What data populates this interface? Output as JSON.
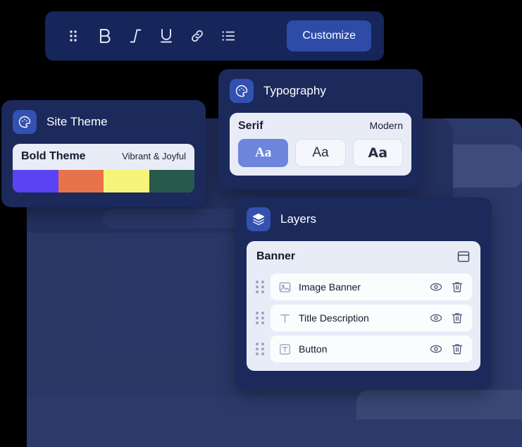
{
  "toolbar": {
    "name": "text-formatting-toolbar",
    "tools": [
      {
        "id": "drag-handle",
        "icon": "drag-handle-icon",
        "label": "Drag"
      },
      {
        "id": "bold",
        "icon": "bold-icon",
        "label": "B"
      },
      {
        "id": "italic",
        "icon": "italic-icon",
        "label": "I"
      },
      {
        "id": "underline",
        "icon": "underline-icon",
        "label": "U"
      },
      {
        "id": "link",
        "icon": "link-icon",
        "label": "Link"
      },
      {
        "id": "list",
        "icon": "bulleted-list-icon",
        "label": "List"
      }
    ],
    "customize_label": "Customize",
    "customize_color": "#2E4BA8",
    "background_color": "#16255A"
  },
  "typography_card": {
    "icon": "palette-icon",
    "title": "Typography",
    "left_label": "Serif",
    "right_label": "Modern",
    "options": [
      {
        "label": "Aa",
        "style": "serif",
        "selected": true
      },
      {
        "label": "Aa",
        "style": "sans",
        "selected": false
      },
      {
        "label": "Aa",
        "style": "bold",
        "selected": false
      }
    ],
    "selected_color": "#6E85DE"
  },
  "site_theme_card": {
    "icon": "palette-icon",
    "title": "Site Theme",
    "theme_name": "Bold Theme",
    "theme_mood": "Vibrant & Joyful",
    "palette": [
      "#5B42F3",
      "#E8734A",
      "#F5F57A",
      "#27594D"
    ]
  },
  "layers_card": {
    "icon": "layers-icon",
    "title": "Layers",
    "section_label": "Banner",
    "section_icon": "layout-window-icon",
    "items": [
      {
        "label": "Image Banner",
        "type_icon": "image-icon"
      },
      {
        "label": "Title Description",
        "type_icon": "text-t-icon"
      },
      {
        "label": "Button",
        "type_icon": "button-boxed-t-icon"
      }
    ],
    "row_actions": [
      {
        "icon": "eye-icon",
        "label": "Toggle visibility"
      },
      {
        "icon": "trash-icon",
        "label": "Delete layer"
      }
    ]
  },
  "background": {
    "panel_color": "#2C3A6B",
    "accent_color": "#3D4C7D",
    "skeleton_color": "#2A3767"
  }
}
